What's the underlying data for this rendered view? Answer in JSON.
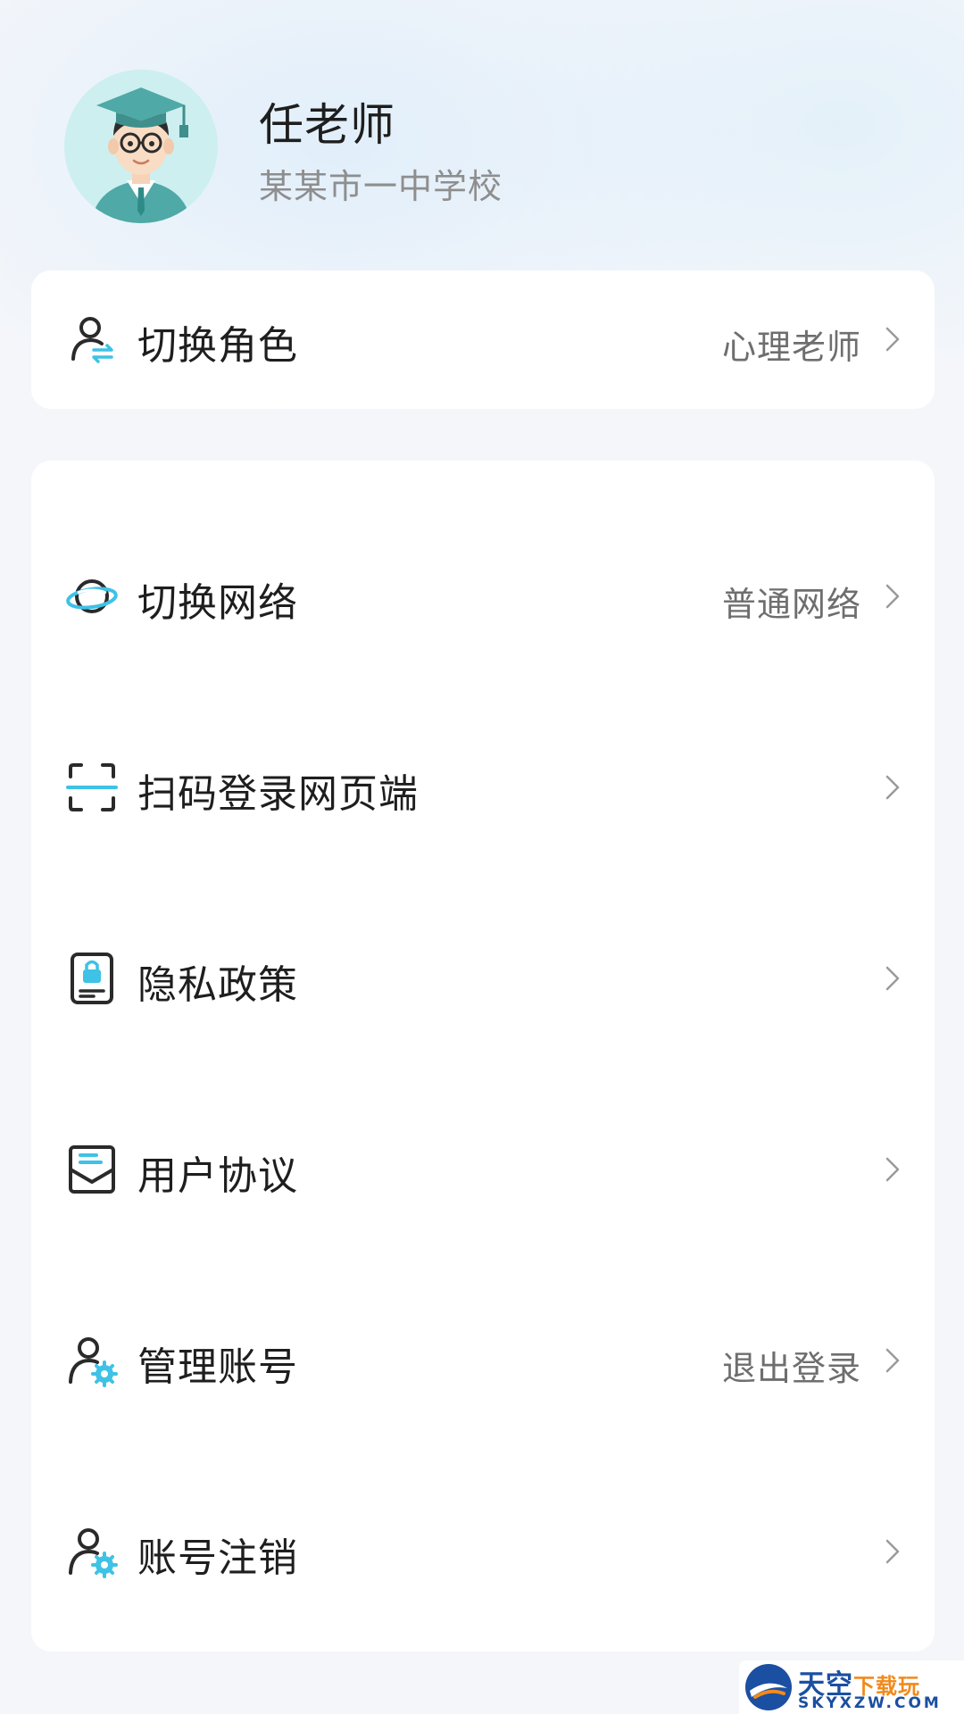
{
  "profile": {
    "name": "任老师",
    "school": "某某市一中学校"
  },
  "role_card": {
    "label": "切换角色",
    "value": "心理老师"
  },
  "menu": [
    {
      "key": "network",
      "label": "切换网络",
      "value": "普通网络",
      "icon": "network-planet-icon"
    },
    {
      "key": "scan",
      "label": "扫码登录网页端",
      "value": "",
      "icon": "scan-icon"
    },
    {
      "key": "privacy",
      "label": "隐私政策",
      "value": "",
      "icon": "privacy-lock-icon"
    },
    {
      "key": "agreement",
      "label": "用户协议",
      "value": "",
      "icon": "agreement-mail-icon"
    },
    {
      "key": "account",
      "label": "管理账号",
      "value": "退出登录",
      "icon": "user-gear-icon"
    },
    {
      "key": "cancel",
      "label": "账号注销",
      "value": "",
      "icon": "user-gear-icon"
    }
  ],
  "watermark": {
    "brand": "天空",
    "brand_accent": "下载玩",
    "domain": "SKYXZW.COM"
  },
  "colors": {
    "accent": "#3ec2e6",
    "icon_dark": "#2a2a2a",
    "text_primary": "#1e1e1e",
    "text_secondary": "#8e8e8e"
  }
}
